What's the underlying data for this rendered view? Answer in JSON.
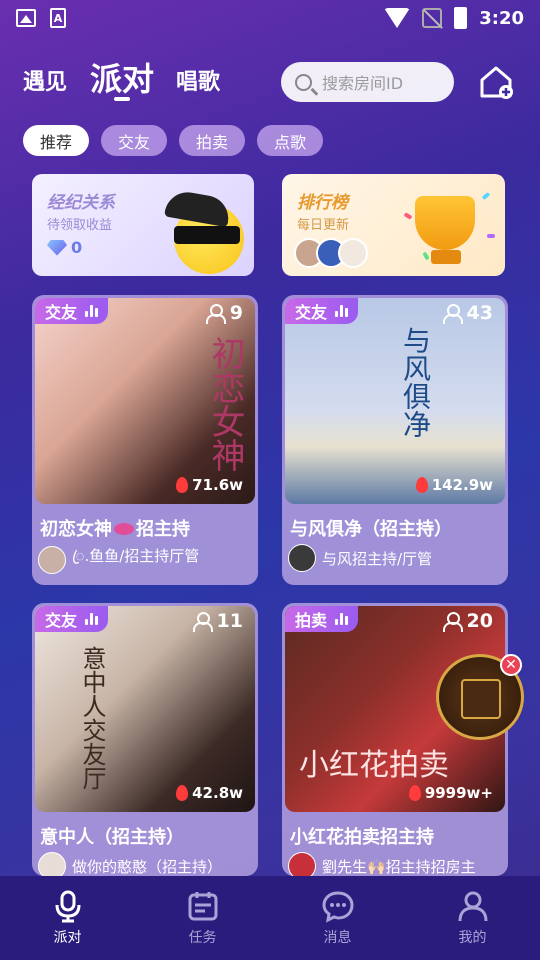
{
  "status_bar": {
    "time": "3:20"
  },
  "header": {
    "tabs": [
      {
        "label": "遇见"
      },
      {
        "label": "派对"
      },
      {
        "label": "唱歌"
      }
    ],
    "search_placeholder": "搜索房间ID"
  },
  "chips": [
    {
      "label": "推荐"
    },
    {
      "label": "交友"
    },
    {
      "label": "拍卖"
    },
    {
      "label": "点歌"
    }
  ],
  "banners": {
    "agent": {
      "title": "经纪关系",
      "subtitle": "待领取收益",
      "amount": "0"
    },
    "rank": {
      "title": "排行榜",
      "subtitle": "每日更新"
    }
  },
  "rooms": [
    {
      "tag": "交友",
      "viewers": "9",
      "heat": "71.6w",
      "deco": "初恋女神",
      "title_a": "初恋女神",
      "title_b": "招主持",
      "host": "ꦿ.鱼鱼/招主持厅管"
    },
    {
      "tag": "交友",
      "viewers": "43",
      "heat": "142.9w",
      "deco": "与风俱净",
      "title": "与风俱净（招主持）",
      "host": "与风招主持/厅管"
    },
    {
      "tag": "交友",
      "viewers": "11",
      "heat": "42.8w",
      "deco": "意中人交友厅",
      "title": "意中人（招主持）",
      "host": "做你的憨憨（招主持）"
    },
    {
      "tag": "拍卖",
      "viewers": "20",
      "heat": "9999w+",
      "deco": "小红花拍卖",
      "title": "小红花拍卖招主持",
      "host": "劉先生🙌🏻招主持招房主"
    }
  ],
  "bottom_nav": [
    {
      "label": "派对",
      "icon": "mic-icon"
    },
    {
      "label": "任务",
      "icon": "calendar-icon"
    },
    {
      "label": "消息",
      "icon": "chat-icon"
    },
    {
      "label": "我的",
      "icon": "person-icon"
    }
  ],
  "colors": {
    "tag_gradient_start": "#c769e8",
    "tag_gradient_end": "#9a5bf0",
    "nav_background": "#2a1c7c"
  }
}
